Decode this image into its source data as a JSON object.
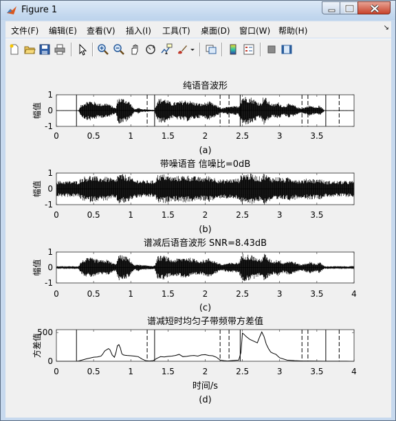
{
  "window": {
    "title": "Figure 1"
  },
  "menu": {
    "items": [
      {
        "label": "文件(F)"
      },
      {
        "label": "编辑(E)"
      },
      {
        "label": "查看(V)"
      },
      {
        "label": "插入(I)"
      },
      {
        "label": "工具(T)"
      },
      {
        "label": "桌面(D)"
      },
      {
        "label": "窗口(W)"
      },
      {
        "label": "帮助(H)"
      }
    ]
  },
  "toolbar": {
    "icons": [
      "new-figure-icon",
      "open-file-icon",
      "save-icon",
      "print-icon",
      "pointer-icon",
      "zoom-in-icon",
      "zoom-out-icon",
      "pan-icon",
      "rotate-3d-icon",
      "data-cursor-icon",
      "brush-icon",
      "brush-dropdown-icon",
      "link-plot-icon",
      "insert-colorbar-icon",
      "insert-legend-icon",
      "hide-plot-tools-icon",
      "show-plot-tools-icon"
    ]
  },
  "chart_data": [
    {
      "type": "line",
      "title": "纯语音波形",
      "ylabel": "幅值",
      "xlabel": "",
      "caption": "(a)",
      "xlim": [
        0,
        4
      ],
      "ylim": [
        -1,
        1
      ],
      "xticks": [
        "0",
        "0.5",
        "1",
        "1.5",
        "2",
        "2.5",
        "3",
        "3.5"
      ],
      "yticks": [
        "1",
        "0",
        "-1"
      ],
      "solid_markers": [
        0.27,
        1.32,
        2.47,
        3.62
      ],
      "dashed_markers": [
        1.22,
        2.2,
        2.32,
        3.3,
        3.38,
        3.8
      ],
      "envelope_x": [
        0.3,
        0.33,
        0.38,
        0.45,
        0.52,
        0.6,
        0.68,
        0.75,
        0.8,
        0.82,
        0.84,
        0.88,
        0.93,
        0.98,
        1.02,
        1.05,
        1.1,
        1.13,
        1.32,
        1.36,
        1.45,
        1.55,
        1.65,
        1.75,
        1.85,
        1.95,
        2.05,
        2.15,
        2.22,
        2.3,
        2.45,
        2.5,
        2.55,
        2.62,
        2.7,
        2.75,
        2.78,
        2.8,
        2.83,
        2.88,
        2.92,
        2.98,
        3.05,
        3.12,
        3.2,
        3.25,
        3.3,
        3.4,
        3.5,
        3.53,
        3.6
      ],
      "envelope_amp": [
        0.05,
        0.35,
        0.55,
        0.65,
        0.55,
        0.45,
        0.5,
        0.3,
        0.15,
        0.7,
        0.85,
        0.8,
        0.75,
        0.6,
        0.3,
        0.08,
        0.2,
        0.1,
        0.05,
        0.75,
        0.8,
        0.5,
        0.6,
        0.7,
        0.55,
        0.45,
        0.6,
        0.35,
        0.15,
        0.25,
        0.3,
        0.95,
        0.9,
        0.85,
        0.6,
        0.5,
        0.9,
        0.95,
        0.7,
        0.5,
        0.4,
        0.55,
        0.3,
        0.45,
        0.35,
        0.2,
        0.15,
        0.35,
        0.2,
        0.35,
        0.05
      ]
    },
    {
      "type": "line",
      "title": "带噪语音 信噪比=0dB",
      "ylabel": "幅值",
      "xlabel": "",
      "caption": "(b)",
      "xlim": [
        0,
        4
      ],
      "ylim": [
        -1,
        1
      ],
      "xticks": [
        "0",
        "0.5",
        "1",
        "1.5",
        "2",
        "2.5",
        "3",
        "3.5"
      ],
      "yticks": [
        "1",
        "0",
        "-1"
      ]
    },
    {
      "type": "line",
      "title": "谱减后语音波形 SNR=8.43dB",
      "ylabel": "幅值",
      "xlabel": "",
      "caption": "(c)",
      "xlim": [
        0,
        4
      ],
      "ylim": [
        -1,
        1
      ],
      "xticks": [
        "0",
        "0.5",
        "1",
        "1.5",
        "2",
        "2.5",
        "3",
        "3.5",
        "4"
      ],
      "yticks": [
        "1",
        "0",
        "-1"
      ]
    },
    {
      "type": "line",
      "title": "谱减短时均匀子带频带方差值",
      "ylabel": "方差值",
      "xlabel": "时间/s",
      "caption": "(d)",
      "xlim": [
        0,
        4
      ],
      "ylim": [
        0,
        550
      ],
      "xticks": [
        "0",
        "0.5",
        "1",
        "1.5",
        "2",
        "2.5",
        "3",
        "3.5",
        "4"
      ],
      "yticks": [
        "500",
        "0"
      ],
      "solid_markers": [
        0.27,
        1.32,
        2.47,
        3.62
      ],
      "dashed_markers": [
        1.22,
        2.2,
        2.32,
        3.3,
        3.38,
        3.8
      ],
      "x": [
        0.0,
        0.1,
        0.2,
        0.27,
        0.3,
        0.4,
        0.5,
        0.55,
        0.6,
        0.62,
        0.65,
        0.7,
        0.72,
        0.75,
        0.78,
        0.8,
        0.82,
        0.84,
        0.86,
        0.88,
        0.9,
        0.92,
        0.95,
        1.0,
        1.05,
        1.1,
        1.15,
        1.2,
        1.25,
        1.3,
        1.35,
        1.4,
        1.45,
        1.5,
        1.55,
        1.6,
        1.65,
        1.7,
        1.75,
        1.8,
        1.85,
        1.9,
        1.95,
        2.0,
        2.05,
        2.1,
        2.15,
        2.2,
        2.25,
        2.3,
        2.35,
        2.4,
        2.45,
        2.48,
        2.5,
        2.52,
        2.55,
        2.6,
        2.65,
        2.7,
        2.73,
        2.76,
        2.79,
        2.82,
        2.85,
        2.88,
        2.91,
        2.95,
        3.0,
        3.1,
        3.2,
        3.3,
        3.4,
        3.5,
        3.6,
        3.7,
        3.8,
        3.9,
        4.0
      ],
      "y": [
        0,
        0,
        0,
        0,
        5,
        40,
        70,
        75,
        90,
        120,
        180,
        220,
        200,
        110,
        70,
        150,
        270,
        290,
        230,
        130,
        110,
        105,
        100,
        95,
        90,
        80,
        40,
        10,
        5,
        10,
        50,
        80,
        75,
        85,
        90,
        100,
        120,
        80,
        85,
        95,
        100,
        90,
        110,
        115,
        100,
        95,
        70,
        20,
        10,
        5,
        10,
        15,
        20,
        150,
        490,
        470,
        430,
        380,
        350,
        320,
        420,
        510,
        430,
        300,
        220,
        160,
        140,
        120,
        60,
        20,
        10,
        5,
        5,
        3,
        2,
        2,
        1,
        1,
        0
      ]
    }
  ]
}
